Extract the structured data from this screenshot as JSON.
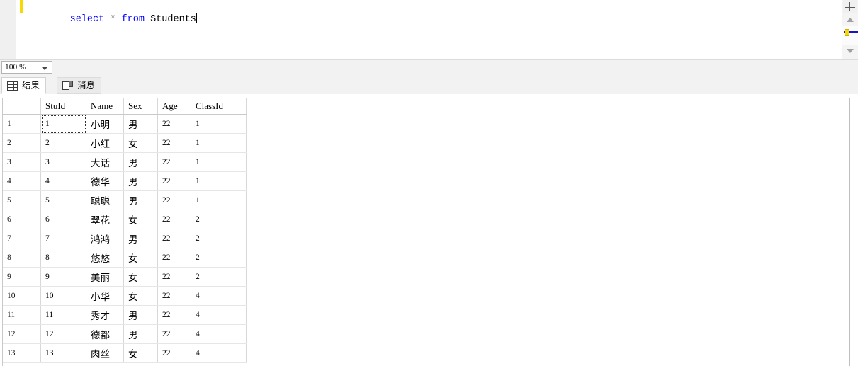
{
  "editor": {
    "query_tokens": [
      {
        "text": "select",
        "type": "keyword"
      },
      {
        "text": " ",
        "type": "plain"
      },
      {
        "text": "*",
        "type": "operator"
      },
      {
        "text": " ",
        "type": "plain"
      },
      {
        "text": "from",
        "type": "keyword"
      },
      {
        "text": " ",
        "type": "plain"
      },
      {
        "text": "Students",
        "type": "identifier"
      }
    ],
    "query_text": "select * from Students",
    "change_bar_color": "#f5d900",
    "keyword_color": "#0000ff",
    "operator_color": "#808080",
    "identifier_color": "#000000",
    "split_bar_icon": "split-bar-icon",
    "scroll_up_icon": "scroll-up-arrow-icon",
    "scroll_down_icon": "scroll-down-arrow-icon"
  },
  "zoom_bar": {
    "value": "100 %",
    "dropdown_icon": "chevron-down-icon"
  },
  "tabs": [
    {
      "label": "结果",
      "icon": "grid-icon",
      "active": true
    },
    {
      "label": "消息",
      "icon": "message-document-icon",
      "active": false
    }
  ],
  "grid": {
    "columns": [
      "",
      "StuId",
      "Name",
      "Sex",
      "Age",
      "ClassId"
    ],
    "selected_cell": {
      "row": 0,
      "col": 1
    },
    "selection_color": "#dde5ec",
    "rows": [
      {
        "n": "1",
        "StuId": "1",
        "Name": "小明",
        "Sex": "男",
        "Age": "22",
        "ClassId": "1"
      },
      {
        "n": "2",
        "StuId": "2",
        "Name": "小红",
        "Sex": "女",
        "Age": "22",
        "ClassId": "1"
      },
      {
        "n": "3",
        "StuId": "3",
        "Name": "大话",
        "Sex": "男",
        "Age": "22",
        "ClassId": "1"
      },
      {
        "n": "4",
        "StuId": "4",
        "Name": "德华",
        "Sex": "男",
        "Age": "22",
        "ClassId": "1"
      },
      {
        "n": "5",
        "StuId": "5",
        "Name": "聪聪",
        "Sex": "男",
        "Age": "22",
        "ClassId": "1"
      },
      {
        "n": "6",
        "StuId": "6",
        "Name": "翠花",
        "Sex": "女",
        "Age": "22",
        "ClassId": "2"
      },
      {
        "n": "7",
        "StuId": "7",
        "Name": "鸿鸿",
        "Sex": "男",
        "Age": "22",
        "ClassId": "2"
      },
      {
        "n": "8",
        "StuId": "8",
        "Name": "悠悠",
        "Sex": "女",
        "Age": "22",
        "ClassId": "2"
      },
      {
        "n": "9",
        "StuId": "9",
        "Name": "美丽",
        "Sex": "女",
        "Age": "22",
        "ClassId": "2"
      },
      {
        "n": "10",
        "StuId": "10",
        "Name": "小华",
        "Sex": "女",
        "Age": "22",
        "ClassId": "4"
      },
      {
        "n": "11",
        "StuId": "11",
        "Name": "秀才",
        "Sex": "男",
        "Age": "22",
        "ClassId": "4"
      },
      {
        "n": "12",
        "StuId": "12",
        "Name": "德都",
        "Sex": "男",
        "Age": "22",
        "ClassId": "4"
      },
      {
        "n": "13",
        "StuId": "13",
        "Name": "肉丝",
        "Sex": "女",
        "Age": "22",
        "ClassId": "4"
      }
    ]
  }
}
